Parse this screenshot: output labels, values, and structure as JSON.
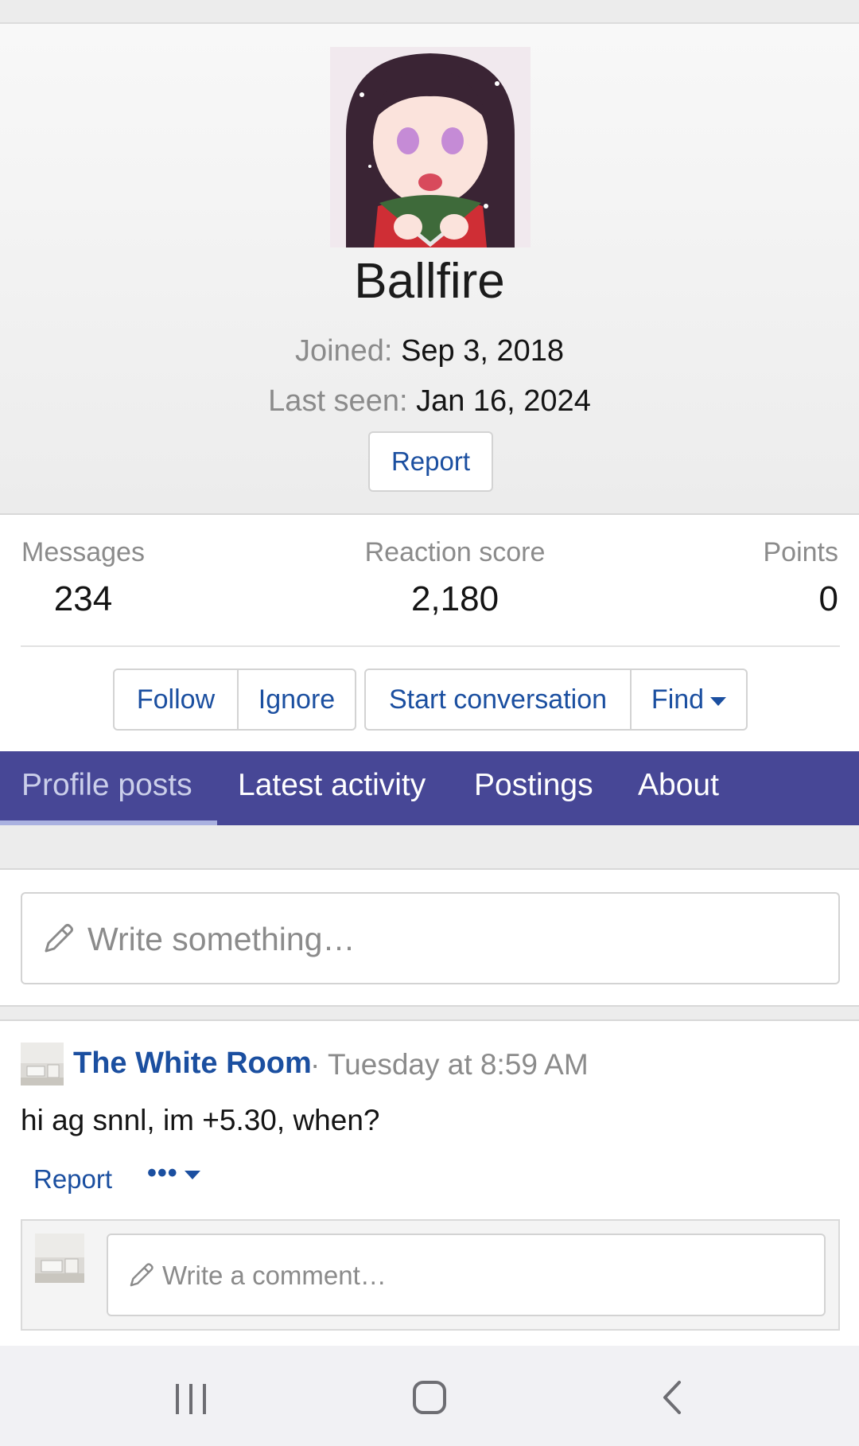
{
  "profile": {
    "username": "Ballfire",
    "joined_label": "Joined:",
    "joined_value": "Sep 3, 2018",
    "last_seen_label": "Last seen:",
    "last_seen_value": "Jan 16, 2024",
    "report_label": "Report"
  },
  "stats": [
    {
      "label": "Messages",
      "value": "234"
    },
    {
      "label": "Reaction score",
      "value": "2,180"
    },
    {
      "label": "Points",
      "value": "0"
    }
  ],
  "actions": {
    "follow": "Follow",
    "ignore": "Ignore",
    "start_conversation": "Start conversation",
    "find": "Find"
  },
  "tabs": [
    {
      "label": "Profile posts",
      "active": true
    },
    {
      "label": "Latest activity",
      "active": false
    },
    {
      "label": "Postings",
      "active": false
    },
    {
      "label": "About",
      "active": false
    }
  ],
  "composer": {
    "placeholder": "Write something…"
  },
  "post": {
    "author": "The White Room",
    "separator": "·",
    "time": "Tuesday at 8:59 AM",
    "body": "hi ag snnl, im +5.30, when?",
    "report_label": "Report",
    "more_label": "•••",
    "comment_placeholder": "Write a comment…"
  },
  "colors": {
    "accent_link": "#1b4fa0",
    "tab_bar": "#474796",
    "tab_active_text": "#cbcfea"
  },
  "icons": {
    "composer_icon": "pencil-icon",
    "comment_icon": "pencil-icon",
    "find_caret": "caret-down-icon",
    "nav_recent": "recent-apps-icon",
    "nav_home": "home-icon",
    "nav_back": "back-icon"
  }
}
